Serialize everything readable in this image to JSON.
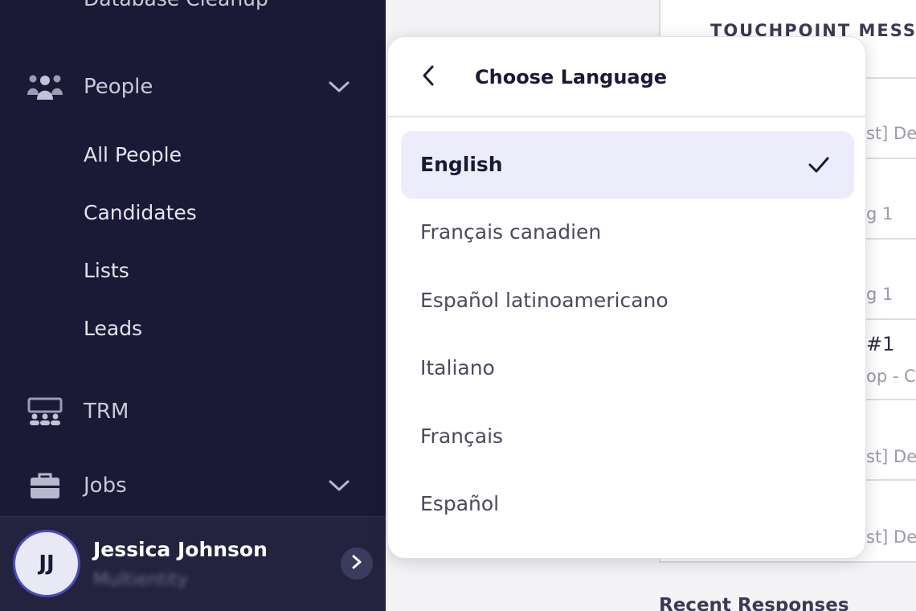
{
  "sidebar": {
    "cut_item": "Database Cleanup",
    "people": {
      "label": "People",
      "icon": "people-group-icon",
      "chevron": "chevron-down-icon"
    },
    "people_subitems": [
      "All People",
      "Candidates",
      "Lists",
      "Leads"
    ],
    "trm": {
      "label": "TRM",
      "icon": "presentation-audience-icon"
    },
    "jobs": {
      "label": "Jobs",
      "icon": "briefcase-icon",
      "chevron": "chevron-down-icon"
    },
    "user": {
      "initials": "JJ",
      "name": "Jessica Johnson",
      "org": "Multientity",
      "icon": "chevron-right-icon"
    }
  },
  "background": {
    "panel_header": "TOUCHPOINT MESSA",
    "rows": [
      {
        "text": "st] De"
      },
      {
        "text": "g 1"
      },
      {
        "text": "g 1"
      },
      {
        "title": "#1",
        "text": "op - C"
      },
      {
        "text": "st] De"
      },
      {
        "text": "st] De"
      }
    ],
    "recent_heading": "Recent Responses"
  },
  "popup": {
    "title": "Choose Language",
    "back_icon": "chevron-left-icon",
    "selected_index": 0,
    "check_icon": "check-icon",
    "options": [
      "English",
      "Français canadien",
      "Español latinoamericano",
      "Italiano",
      "Français",
      "Español"
    ]
  },
  "colors": {
    "sidebar_bg": "#1a1a36",
    "selected_option_bg": "#ececfa",
    "avatar_ring": "#4b4bbf"
  }
}
